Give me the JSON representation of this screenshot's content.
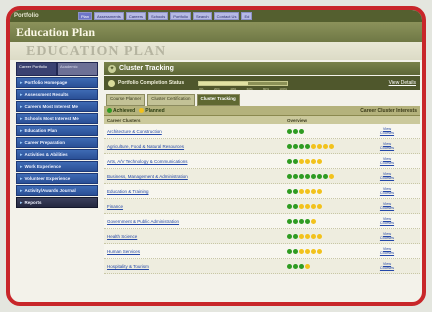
{
  "topnav": {
    "brand": "Portfolio",
    "tabs": [
      "Plan",
      "Assessments",
      "Careers",
      "Schools",
      "Portfolio",
      "Search",
      "Contact Us",
      "Ed"
    ]
  },
  "header": {
    "title": "Education Plan",
    "watermark": "EDUCATION PLAN"
  },
  "sidebar": {
    "tabs": [
      "Career Portfolio",
      "Academic"
    ],
    "items": [
      "Portfolio Homepage",
      "Assessment Results",
      "Careers Most Interest Me",
      "Schools Most Interest Me",
      "Education Plan",
      "Career Preparation",
      "Activities & Abilities",
      "Work Experience",
      "Volunteer Experience",
      "Activity/Awards Journal",
      "Reports"
    ]
  },
  "main": {
    "panel_title": "Cluster Tracking",
    "status_label": "Portfolio Completion Status",
    "status_ticks": [
      "0%",
      "20%",
      "40%",
      "60%",
      "80%",
      "100%"
    ],
    "status_progress": 0.55,
    "view_details": "View Details",
    "subtabs": [
      "Course Planner",
      "Cluster Certification",
      "Cluster Tracking"
    ],
    "legend": {
      "achieved": "Achieved",
      "planned": "Planned",
      "right": "Career Cluster Interests"
    },
    "columns": [
      "Career Clusters",
      "Overview"
    ],
    "view_label": "View Courses",
    "colors": {
      "achieved": "#2e9b22",
      "planned": "#f2c21c",
      "empty": "#d6d4b8"
    },
    "rows": [
      {
        "name": "Architecture & Construction",
        "achieved": 3,
        "planned": 0
      },
      {
        "name": "Agriculture, Food & Natural Resources",
        "achieved": 4,
        "planned": 4
      },
      {
        "name": "Arts, A/V Technology & Communications",
        "achieved": 2,
        "planned": 4
      },
      {
        "name": "Business, Management & Administration",
        "achieved": 7,
        "planned": 1
      },
      {
        "name": "Education & Training",
        "achieved": 2,
        "planned": 4
      },
      {
        "name": "Finance",
        "achieved": 2,
        "planned": 4
      },
      {
        "name": "Government & Public Administration",
        "achieved": 4,
        "planned": 1
      },
      {
        "name": "Health Science",
        "achieved": 2,
        "planned": 4
      },
      {
        "name": "Human Services",
        "achieved": 2,
        "planned": 4
      },
      {
        "name": "Hospitality & Tourism",
        "achieved": 3,
        "planned": 1
      }
    ]
  }
}
